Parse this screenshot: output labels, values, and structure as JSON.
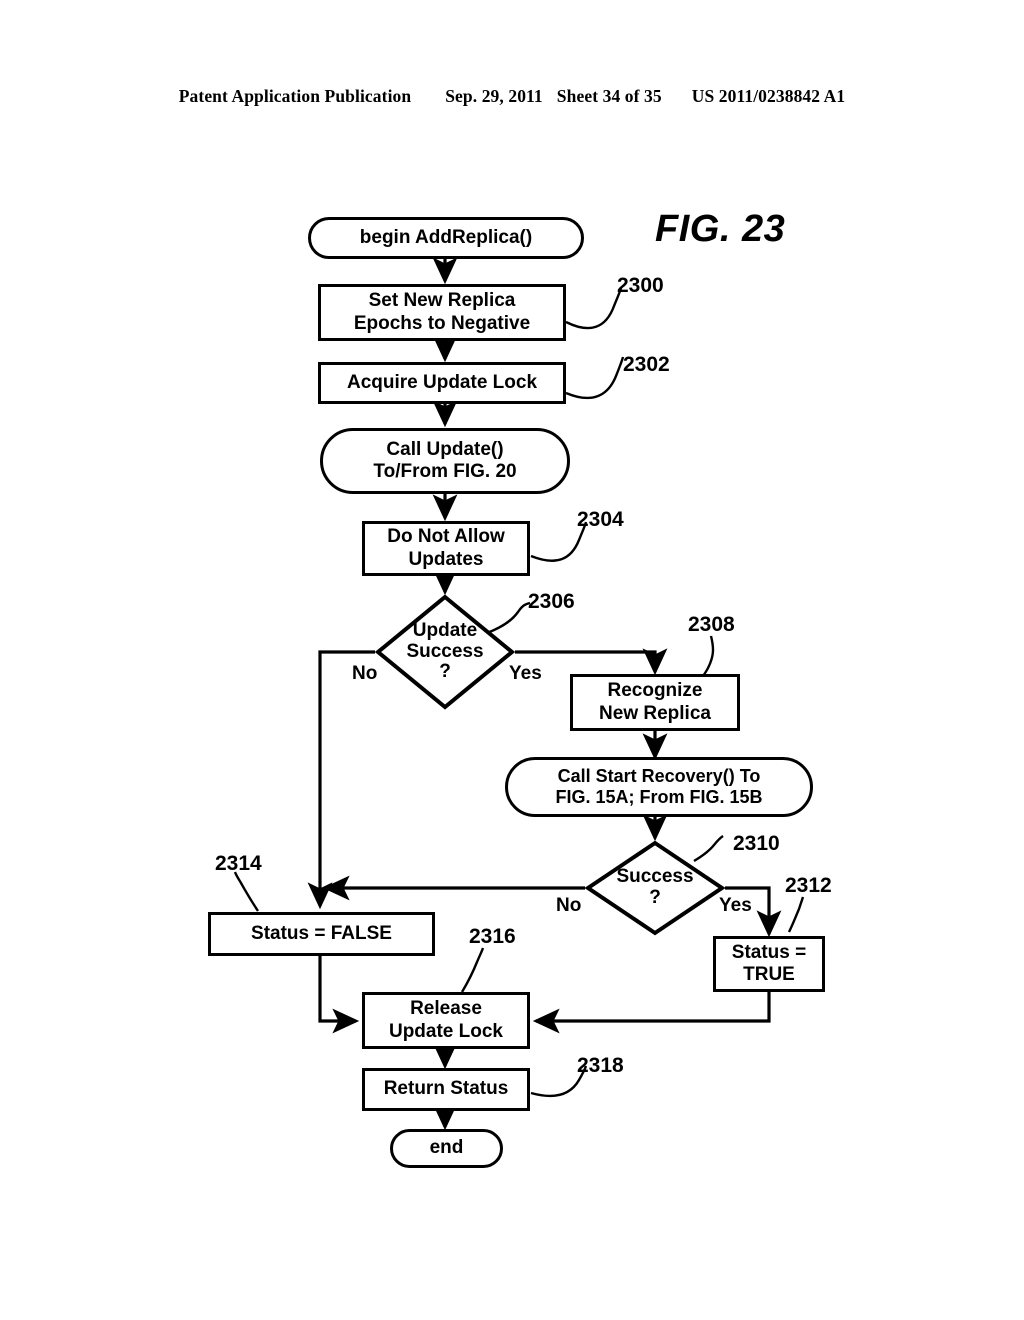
{
  "header": {
    "publication": "Patent Application Publication",
    "date": "Sep. 29, 2011",
    "sheet": "Sheet 34 of 35",
    "patent_number": "US 2011/0238842 A1"
  },
  "figure": {
    "title": "FIG. 23"
  },
  "nodes": {
    "begin": {
      "label": "begin AddReplica()",
      "shape": "terminal"
    },
    "set_epochs": {
      "label": "Set New Replica\nEpochs to Negative",
      "shape": "process",
      "ref": "2300"
    },
    "acquire_lock": {
      "label": "Acquire Update Lock",
      "shape": "process",
      "ref": "2302"
    },
    "call_update": {
      "label": "Call Update()\nTo/From FIG. 20",
      "shape": "terminal"
    },
    "no_updates": {
      "label": "Do Not Allow\nUpdates",
      "shape": "process",
      "ref": "2304"
    },
    "update_success": {
      "label": "Update\nSuccess\n?",
      "shape": "decision",
      "ref": "2306"
    },
    "recognize_replica": {
      "label": "Recognize\nNew Replica",
      "shape": "process",
      "ref": "2308"
    },
    "call_recovery": {
      "label": "Call Start Recovery() To\nFIG. 15A; From FIG. 15B",
      "shape": "terminal"
    },
    "success": {
      "label": "Success\n?",
      "shape": "decision",
      "ref": "2310"
    },
    "status_true": {
      "label": "Status =\nTRUE",
      "shape": "process",
      "ref": "2312"
    },
    "status_false": {
      "label": "Status = FALSE",
      "shape": "process",
      "ref": "2314"
    },
    "release_lock": {
      "label": "Release\nUpdate Lock",
      "shape": "process",
      "ref": "2316"
    },
    "return_status": {
      "label": "Return Status",
      "shape": "process",
      "ref": "2318"
    },
    "end": {
      "label": "end",
      "shape": "terminal"
    }
  },
  "branch_labels": {
    "update_success_no": "No",
    "update_success_yes": "Yes",
    "success_no": "No",
    "success_yes": "Yes"
  },
  "reference_numerals": [
    "2300",
    "2302",
    "2304",
    "2306",
    "2308",
    "2310",
    "2312",
    "2314",
    "2316",
    "2318"
  ],
  "colors": {
    "ink": "#000000",
    "paper": "#ffffff"
  }
}
